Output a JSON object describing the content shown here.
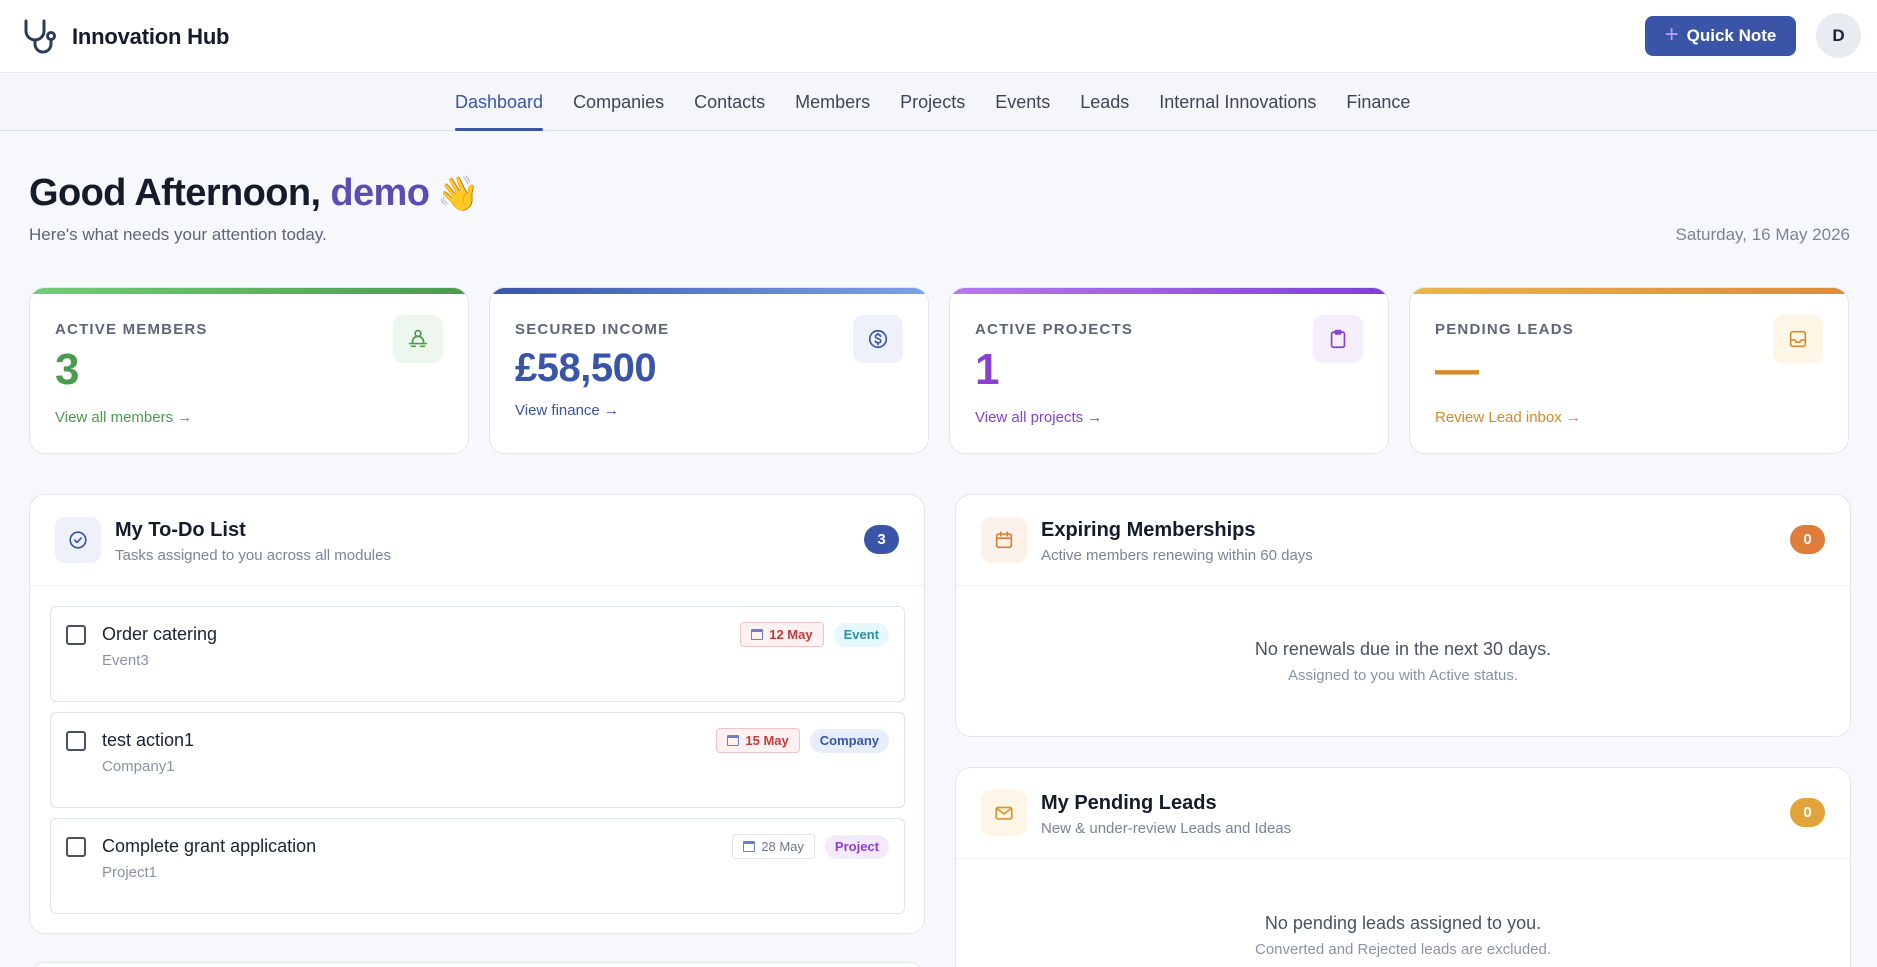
{
  "header": {
    "brand": "Innovation Hub",
    "quick_note": "Quick Note",
    "avatar": "D"
  },
  "nav": [
    "Dashboard",
    "Companies",
    "Contacts",
    "Members",
    "Projects",
    "Events",
    "Leads",
    "Internal Innovations",
    "Finance"
  ],
  "greeting": {
    "salutation": "Good Afternoon, ",
    "user": "demo",
    "wave": "👋",
    "subtitle": "Here's what needs your attention today.",
    "date": "Saturday, 16 May 2026"
  },
  "kpis": {
    "members": {
      "label": "ACTIVE MEMBERS",
      "value": "3",
      "link": "View all members →",
      "color": "#4c9a4f"
    },
    "income": {
      "label": "SECURED INCOME",
      "value": "£58,500",
      "link": "View finance →",
      "color": "#3a55a8"
    },
    "projects": {
      "label": "ACTIVE PROJECTS",
      "value": "1",
      "link": "View all projects →",
      "color": "#8a3fd1"
    },
    "leads": {
      "label": "PENDING LEADS",
      "value": "—",
      "link": "Review Lead inbox →",
      "color": "#d48a2a"
    }
  },
  "todo": {
    "title": "My To-Do List",
    "subtitle": "Tasks assigned to you across all modules",
    "count": "3",
    "items": [
      {
        "title": "Order catering",
        "sub": "Event3",
        "due": "12 May",
        "tag": "Event"
      },
      {
        "title": "test action1",
        "sub": "Company1",
        "due": "15 May",
        "tag": "Company"
      },
      {
        "title": "Complete grant application",
        "sub": "Project1",
        "due": "28 May",
        "tag": "Project"
      }
    ]
  },
  "expiring": {
    "title": "Expiring Memberships",
    "subtitle": "Active members renewing within 60 days",
    "count": "0",
    "empty": "No renewals due in the next 30 days.",
    "empty_sub": "Assigned to you with Active status."
  },
  "pending": {
    "title": "My Pending Leads",
    "subtitle": "New & under-review Leads and Ideas",
    "count": "0",
    "empty": "No pending leads assigned to you.",
    "empty_sub": "Converted and Rejected leads are excluded."
  }
}
